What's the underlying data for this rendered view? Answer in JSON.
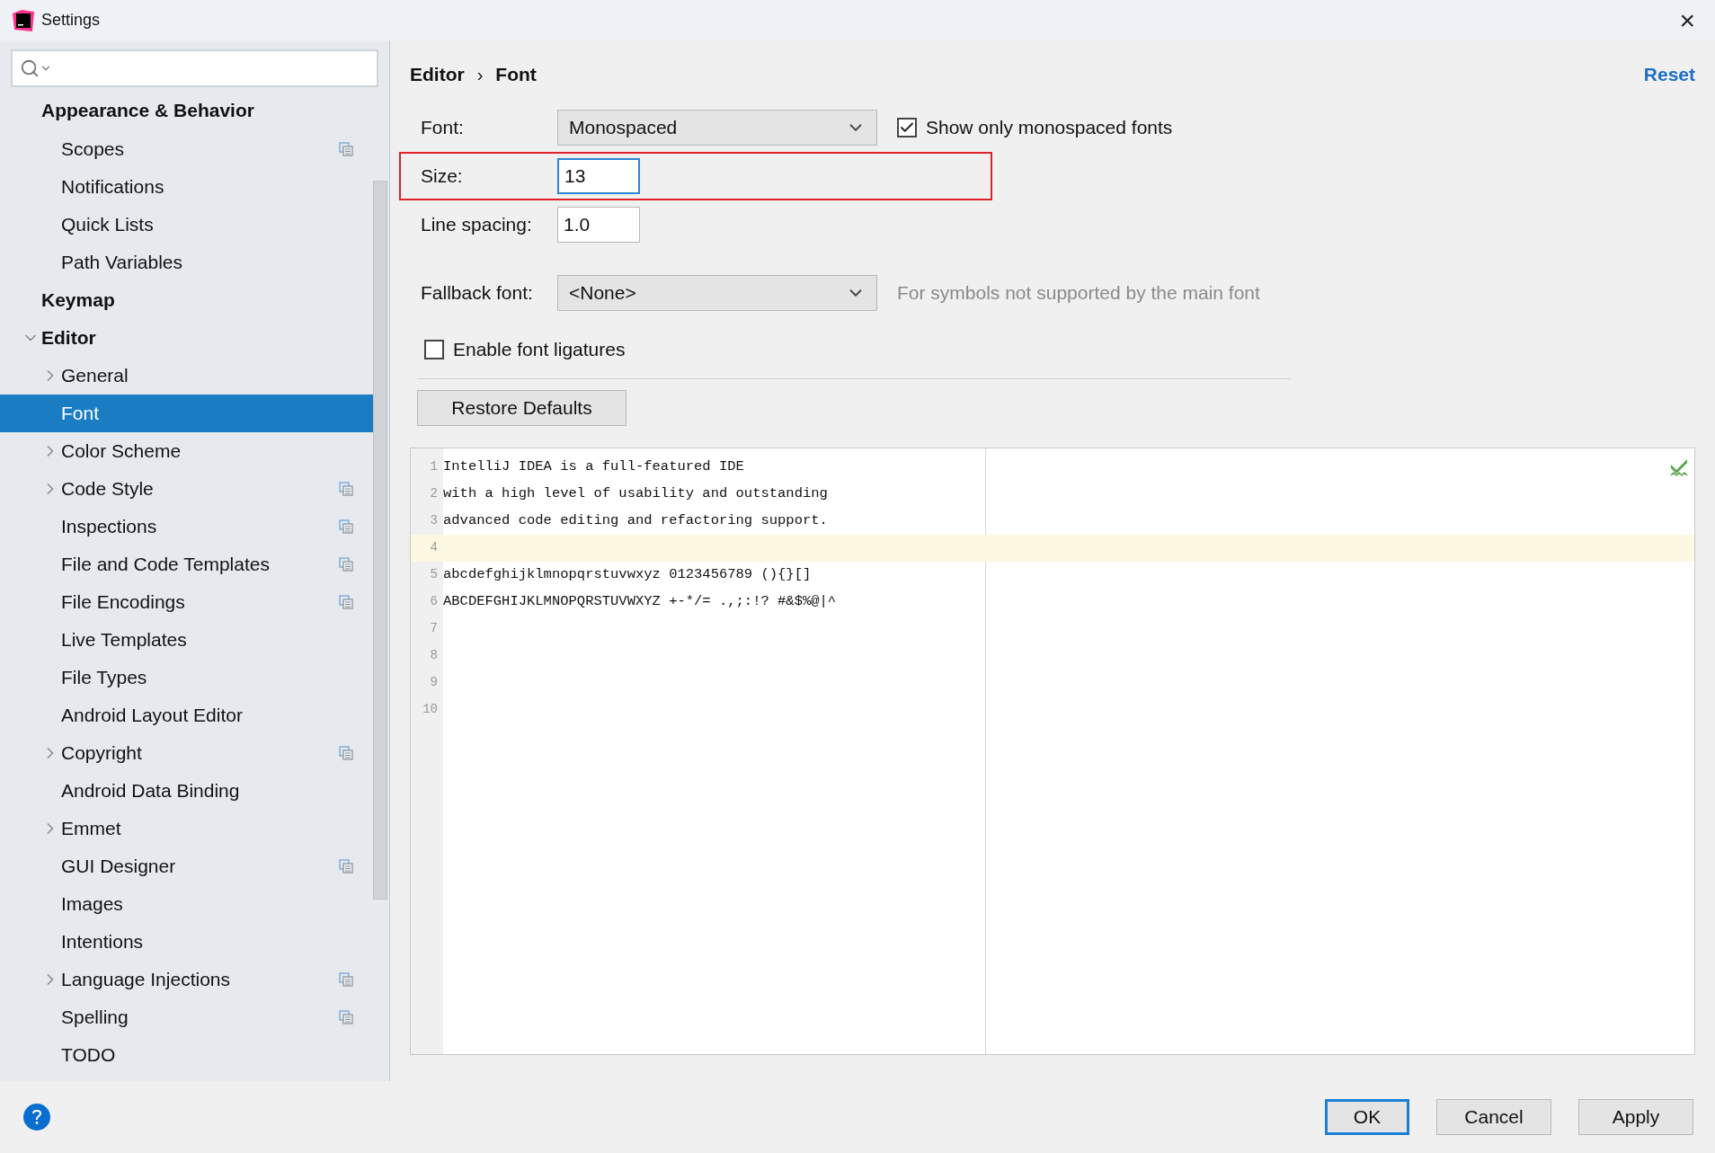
{
  "window": {
    "title": "Settings",
    "close": "×"
  },
  "sidebar": {
    "items": [
      {
        "label": "Appearance & Behavior",
        "children": [
          {
            "label": "Scopes",
            "project_scoped": true
          },
          {
            "label": "Notifications",
            "project_scoped": false
          },
          {
            "label": "Quick Lists",
            "project_scoped": false
          },
          {
            "label": "Path Variables",
            "project_scoped": false
          }
        ]
      },
      {
        "label": "Keymap"
      },
      {
        "label": "Editor",
        "expanded": true,
        "children": [
          {
            "label": "General",
            "expanded": false,
            "project_scoped": false,
            "selected": false
          },
          {
            "label": "Font",
            "project_scoped": false,
            "selected": true
          },
          {
            "label": "Color Scheme",
            "expanded": false,
            "project_scoped": false,
            "selected": false
          },
          {
            "label": "Code Style",
            "expanded": false,
            "project_scoped": true,
            "selected": false
          },
          {
            "label": "Inspections",
            "project_scoped": true,
            "selected": false
          },
          {
            "label": "File and Code Templates",
            "project_scoped": true,
            "selected": false
          },
          {
            "label": "File Encodings",
            "project_scoped": true,
            "selected": false
          },
          {
            "label": "Live Templates",
            "project_scoped": false,
            "selected": false
          },
          {
            "label": "File Types",
            "project_scoped": false,
            "selected": false
          },
          {
            "label": "Android Layout Editor",
            "project_scoped": false,
            "selected": false
          },
          {
            "label": "Copyright",
            "expanded": false,
            "project_scoped": true,
            "selected": false
          },
          {
            "label": "Android Data Binding",
            "project_scoped": false,
            "selected": false
          },
          {
            "label": "Emmet",
            "expanded": false,
            "project_scoped": false,
            "selected": false
          },
          {
            "label": "GUI Designer",
            "project_scoped": true,
            "selected": false
          },
          {
            "label": "Images",
            "project_scoped": false,
            "selected": false
          },
          {
            "label": "Intentions",
            "project_scoped": false,
            "selected": false
          },
          {
            "label": "Language Injections",
            "expanded": false,
            "project_scoped": true,
            "selected": false
          },
          {
            "label": "Spelling",
            "project_scoped": true,
            "selected": false
          },
          {
            "label": "TODO",
            "project_scoped": false,
            "selected": false
          }
        ]
      }
    ]
  },
  "breadcrumb": [
    "Editor",
    "Font"
  ],
  "breadcrumb_separator": "›",
  "reset": "Reset",
  "form": [
    {
      "kind": "dropdown",
      "label": "Font:",
      "value": "Monospaced",
      "highlighted": false,
      "checkbox": {
        "label": "Show only monospaced fonts",
        "checked": true
      }
    },
    {
      "kind": "input",
      "label": "Size:",
      "value": "13",
      "focused": true,
      "highlighted": true
    },
    {
      "kind": "input",
      "label": "Line spacing:",
      "value": "1.0",
      "focused": false,
      "highlighted": false
    },
    {
      "kind": "dropdown",
      "label": "Fallback font:",
      "value": "<None>",
      "highlighted": false,
      "hint": "For symbols not supported by the main font"
    }
  ],
  "ligatures": {
    "label": "Enable font ligatures",
    "checked": false
  },
  "restore_defaults": "Restore Defaults",
  "preview": {
    "lines": [
      {
        "number": "1",
        "text": "IntelliJ IDEA is a full-featured IDE",
        "current": false
      },
      {
        "number": "2",
        "text": "with a high level of usability and outstanding",
        "current": false
      },
      {
        "number": "3",
        "text": "advanced code editing and refactoring support.",
        "current": false
      },
      {
        "number": "4",
        "current": true
      },
      {
        "number": "5",
        "text": "abcdefghijklmnopqrstuvwxyz 0123456789 (){}[]",
        "current": false
      },
      {
        "number": "6",
        "text": "ABCDEFGHIJKLMNOPQRSTUVWXYZ +-*/= .,;:!? #&$%@|^",
        "current": false
      },
      {
        "number": "7",
        "current": false
      },
      {
        "number": "8",
        "current": false
      },
      {
        "number": "9",
        "current": false
      },
      {
        "number": "10",
        "current": false
      }
    ]
  },
  "buttons": [
    {
      "label": "OK",
      "default": true
    },
    {
      "label": "Cancel",
      "default": false
    },
    {
      "label": "Apply",
      "default": false
    }
  ]
}
